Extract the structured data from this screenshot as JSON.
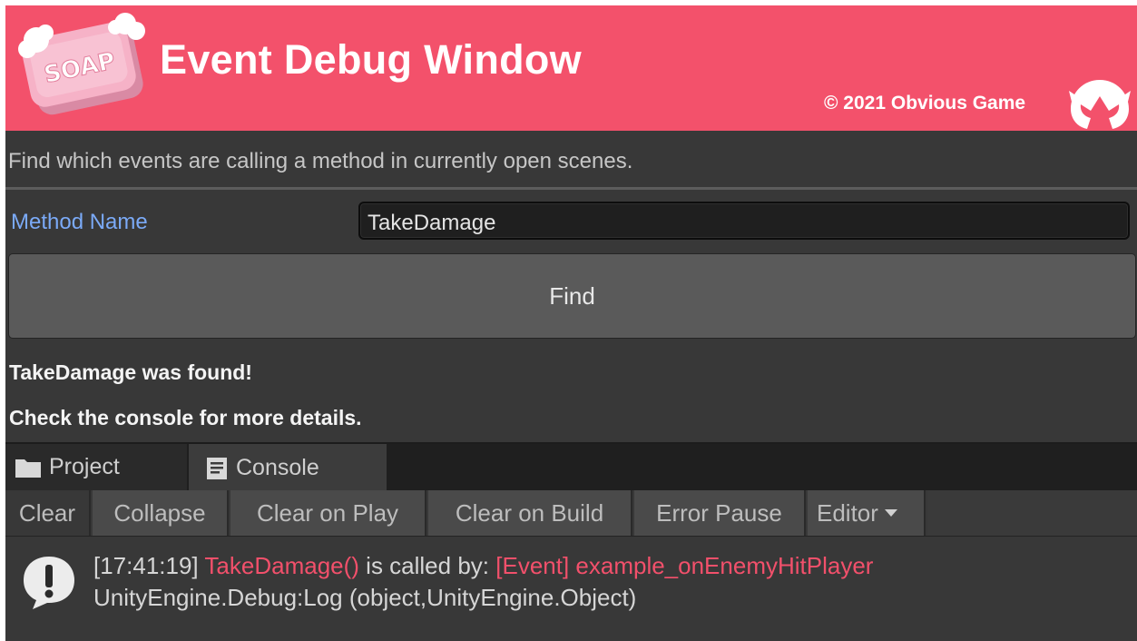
{
  "colors": {
    "banner": "#f3516b",
    "panel": "#383838",
    "label_link": "#7baaf7",
    "log_highlight": "#f2506b"
  },
  "banner": {
    "logo_text": "SOAP",
    "title": "Event Debug Window",
    "copyright": "© 2021 Obvious Game"
  },
  "description": "Find which events are calling a method in currently open scenes.",
  "method_field": {
    "label": "Method Name",
    "value": "TakeDamage"
  },
  "find_button": {
    "label": "Find"
  },
  "result": {
    "line1": "TakeDamage was found!",
    "line2": "Check the console for more details."
  },
  "dock": {
    "tabs": [
      {
        "label": "Project",
        "icon": "folder-icon"
      },
      {
        "label": "Console",
        "icon": "console-icon"
      }
    ],
    "toolbar": {
      "clear": "Clear",
      "collapse": "Collapse",
      "clear_on_play": "Clear on Play",
      "clear_on_build": "Clear on Build",
      "error_pause": "Error Pause",
      "editor": "Editor"
    },
    "log_entry": {
      "timestamp": "[17:41:19]",
      "method": "TakeDamage()",
      "called_by": "is called by:",
      "event": "[Event] example_onEnemyHitPlayer",
      "trace": "UnityEngine.Debug:Log (object,UnityEngine.Object)",
      "icon": "info-log-icon"
    }
  }
}
